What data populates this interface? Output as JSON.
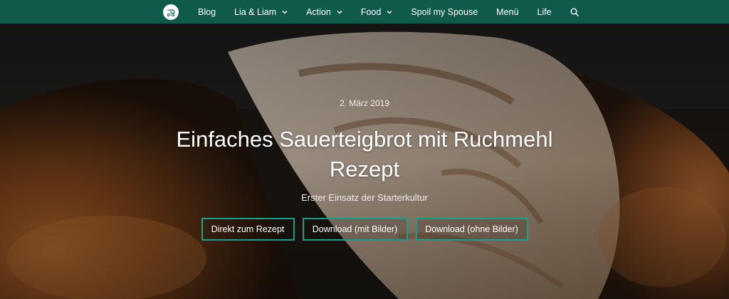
{
  "nav": {
    "logo_icon": "site-logo-icon",
    "items": [
      {
        "label": "Blog",
        "has_dropdown": false
      },
      {
        "label": "Lia & Liam",
        "has_dropdown": true
      },
      {
        "label": "Action",
        "has_dropdown": true
      },
      {
        "label": "Food",
        "has_dropdown": true
      },
      {
        "label": "Spoil my Spouse",
        "has_dropdown": false
      },
      {
        "label": "Menü",
        "has_dropdown": false
      },
      {
        "label": "Life",
        "has_dropdown": false
      }
    ],
    "search_icon": "search-icon",
    "background_color": "#0f5a4b"
  },
  "hero": {
    "date": "2. März 2019",
    "title": "Einfaches Sauerteigbrot mit Ruchmehl Rezept",
    "subtitle": "Erster Einsatz der Starterkultur",
    "buttons": [
      {
        "label": "Direkt zum Rezept"
      },
      {
        "label": "Download (mit Bilder)"
      },
      {
        "label": "Download (ohne Bilder)"
      }
    ],
    "button_border_color": "#1b9e86"
  }
}
